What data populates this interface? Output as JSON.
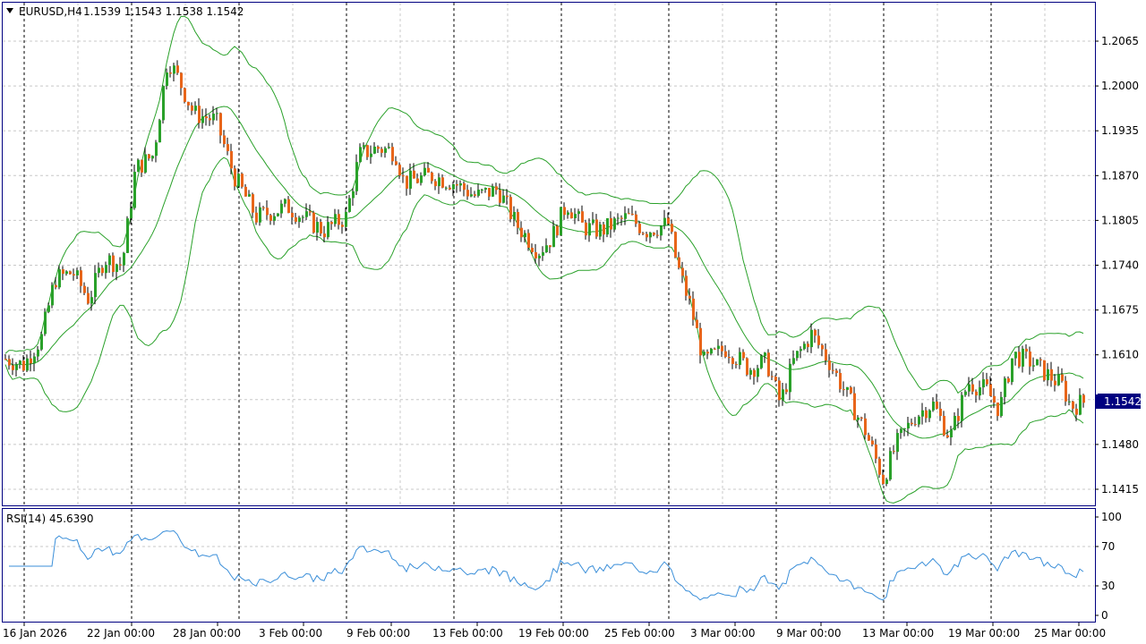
{
  "header": {
    "symbol_tf": "EURUSD,H4",
    "ohlc": "1.1539 1.1543 1.1538 1.1542",
    "rsi_label": "RSI(14) 45.6390"
  },
  "price_axis": {
    "ticks": [
      "1.2065",
      "1.2000",
      "1.1935",
      "1.1870",
      "1.1805",
      "1.1740",
      "1.1675",
      "1.1610",
      "1.1480",
      "1.1415"
    ],
    "current_price": "1.1542",
    "current_price_color": "#000080"
  },
  "rsi_axis": {
    "ticks": [
      "100",
      "70",
      "30",
      "0"
    ]
  },
  "time_axis": {
    "labels": [
      "16 Jan 2026",
      "22 Jan 00:00",
      "28 Jan 00:00",
      "3 Feb 00:00",
      "9 Feb 00:00",
      "13 Feb 00:00",
      "19 Feb 00:00",
      "25 Feb 00:00",
      "3 Mar 00:00",
      "9 Mar 00:00",
      "13 Mar 00:00",
      "19 Mar 00:00",
      "25 Mar 00:00"
    ]
  },
  "colors": {
    "bull_candle": "#2aa12a",
    "bear_candle": "#e8651a",
    "bollinger": "#2aa12a",
    "rsi_line": "#3b8fd9",
    "frame": "#000080",
    "grid": "#c8c8c8"
  },
  "chart_data": {
    "type": "candlestick",
    "symbol": "EURUSD",
    "timeframe": "H4",
    "price_range": [
      1.1395,
      1.211
    ],
    "indicators": [
      "Bollinger Bands",
      "RSI(14)"
    ],
    "price_path": [
      [
        "16 Jan 2026",
        1.161
      ],
      [
        "22 Jan 00:00",
        1.174
      ],
      [
        "28 Jan 00:00",
        1.2
      ],
      [
        "3 Feb 00:00",
        1.179
      ],
      [
        "9 Feb 00:00",
        1.191
      ],
      [
        "13 Feb 00:00",
        1.186
      ],
      [
        "19 Feb 00:00",
        1.176
      ],
      [
        "25 Feb 00:00",
        1.18
      ],
      [
        "3 Mar 00:00",
        1.161
      ],
      [
        "9 Mar 00:00",
        1.16
      ],
      [
        "13 Mar 00:00",
        1.143
      ],
      [
        "19 Mar 00:00",
        1.155
      ],
      [
        "25 Mar 00:00",
        1.1542
      ]
    ],
    "rsi_range": [
      0,
      100
    ],
    "rsi_levels": [
      70,
      30
    ],
    "rsi_last": 45.639
  }
}
